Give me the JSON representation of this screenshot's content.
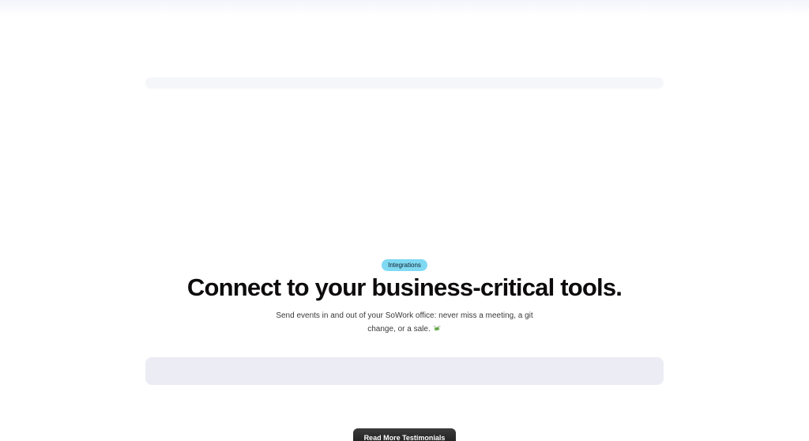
{
  "integrations": {
    "badge": "Integrations",
    "headline": "Connect to your business-critical tools.",
    "description": "Send events in and out of your SoWork office: never miss a meeting, a git change, or a sale.",
    "emoji_icon": "money-with-wings-icon"
  },
  "cta": {
    "label": "Read More Testimonials"
  },
  "colors": {
    "badge_bg": "#7fd9f3",
    "headline": "#0d0b0c",
    "logos_strip_bg": "#ececf4",
    "button_bg": "#1f1f1f"
  }
}
